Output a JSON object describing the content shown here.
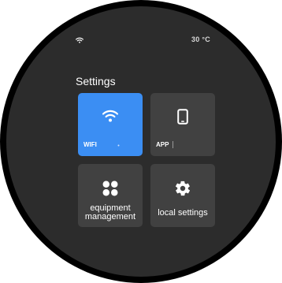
{
  "status": {
    "wifi_icon": "wifi-icon",
    "temperature": "30 °C"
  },
  "page": {
    "title": "Settings"
  },
  "tiles": [
    {
      "id": "wifi",
      "label": "WIFI",
      "icon": "wifi-icon",
      "active": true
    },
    {
      "id": "app",
      "label": "APP",
      "icon": "smartphone-icon",
      "active": false
    },
    {
      "id": "equipment",
      "label_line1": "equipment",
      "label_line2": "management",
      "icon": "four-petal-icon",
      "active": false
    },
    {
      "id": "local",
      "label": "local settings",
      "icon": "gear-icon",
      "active": false
    }
  ],
  "colors": {
    "screen_bg": "#2c2c2c",
    "tile_bg": "#414141",
    "accent": "#3b8ef3",
    "text": "#ffffff"
  }
}
